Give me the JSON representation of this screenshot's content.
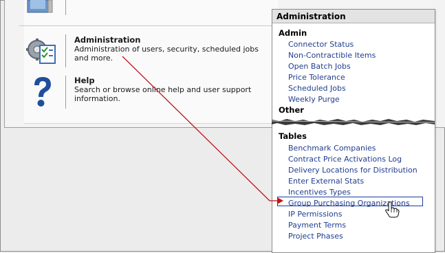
{
  "home": {
    "items": [
      {
        "title": "Administration",
        "description": "Administration of users, security, scheduled jobs and more."
      },
      {
        "title": "Help",
        "description": "Search or browse online help and user support information."
      }
    ]
  },
  "admin_menu": {
    "title": "Administration",
    "sections": [
      {
        "label": "Admin",
        "items": [
          "Connector Status",
          "Non-Contractible Items",
          "Open Batch Jobs",
          "Price Tolerance",
          "Scheduled Jobs",
          "Weekly Purge"
        ]
      },
      {
        "label": "Other",
        "items": []
      },
      {
        "label": "Tables",
        "items": [
          "Benchmark Companies",
          "Contract Price Activations Log",
          "Delivery Locations for Distribution",
          "Enter External Stats",
          "Incentives Types",
          "Group Purchasing Organizations",
          "IP Permissions",
          "Payment Terms",
          "Project Phases"
        ]
      }
    ]
  },
  "colors": {
    "link": "#1f3d8f",
    "annotation": "#c0151b",
    "highlight_border": "#1c3aa0"
  },
  "icons": {
    "admin": "gears-checklist-icon",
    "help": "question-mark-icon",
    "pointer": "hand-pointer-icon"
  }
}
